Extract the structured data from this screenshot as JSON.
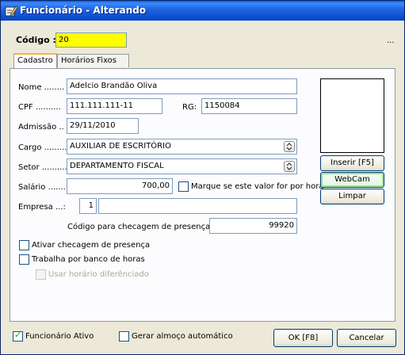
{
  "window": {
    "title": "Funcionário - Alterando"
  },
  "header": {
    "codigo_label": "Código :",
    "codigo_value": "20",
    "ellipsis": "..."
  },
  "tabs": [
    {
      "label": "Cadastro"
    },
    {
      "label": "Horários Fixos"
    }
  ],
  "form": {
    "nome_label": "Nome ........",
    "nome_value": "Adelcio Brandão Oliva",
    "cpf_label": "CPF ..........",
    "cpf_value": "111.111.111-11",
    "rg_label": "RG:",
    "rg_value": "1150084",
    "admissao_label": "Admissão ..",
    "admissao_value": "29/11/2010",
    "cargo_label": "Cargo .........",
    "cargo_value": "AUXILIAR DE ESCRITÓRIO",
    "setor_label": "Setor ..........",
    "setor_value": "DEPARTAMENTO FISCAL",
    "salario_label": "Salário .......",
    "salario_value": "700,00",
    "salario_check_label": "Marque se este valor for por hora",
    "empresa_label": "Empresa ...:",
    "empresa_code": "1",
    "empresa_name": "",
    "checagem_label": "Código para checagem de presença :",
    "checagem_value": "99920",
    "ativar_checagem_label": "Ativar checagem de presença",
    "banco_horas_label": "Trabalha por banco de horas",
    "horario_dif_label": "Usar horário diferênciado"
  },
  "photo_buttons": {
    "inserir": "Inserir  [F5]",
    "webcam": "WebCam",
    "limpar": "Limpar"
  },
  "footer": {
    "ativo_label": "Funcionário Ativo",
    "ativo_checked": true,
    "almoco_label": "Gerar almoço automático",
    "almoco_checked": false,
    "ok_label": "OK  [F8]",
    "cancel_label": "Cancelar"
  }
}
